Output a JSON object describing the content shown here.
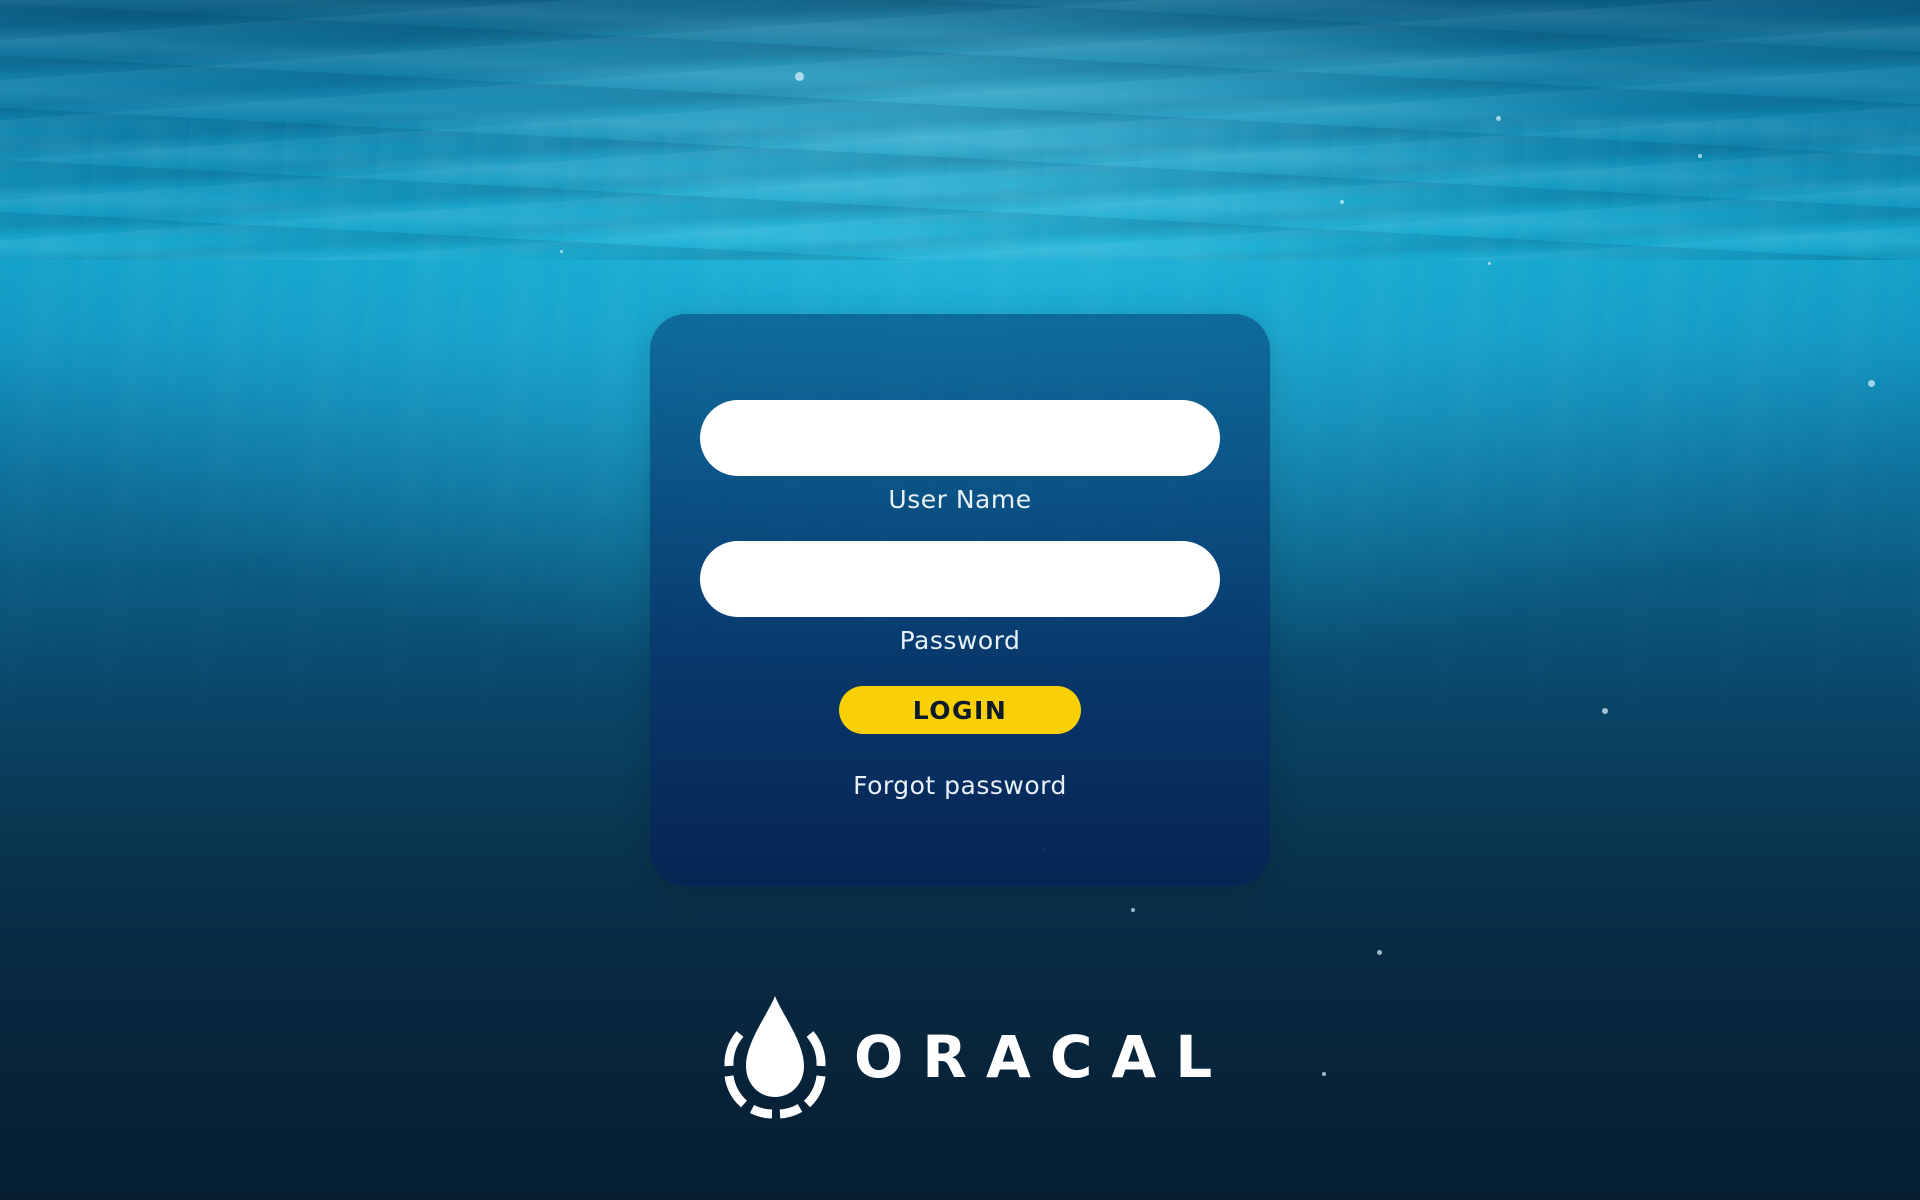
{
  "login_form": {
    "username_value": "",
    "username_label": "User Name",
    "password_value": "",
    "password_label": "Password",
    "login_button_label": "LOGIN",
    "forgot_password_label": "Forgot password"
  },
  "brand": {
    "name": "ORACAL",
    "logo_icon": "water-drop-icon"
  },
  "colors": {
    "accent": "#f9cf06",
    "card": "#0a3d6e",
    "field": "#ffffff",
    "text": "#e8f1f8"
  }
}
